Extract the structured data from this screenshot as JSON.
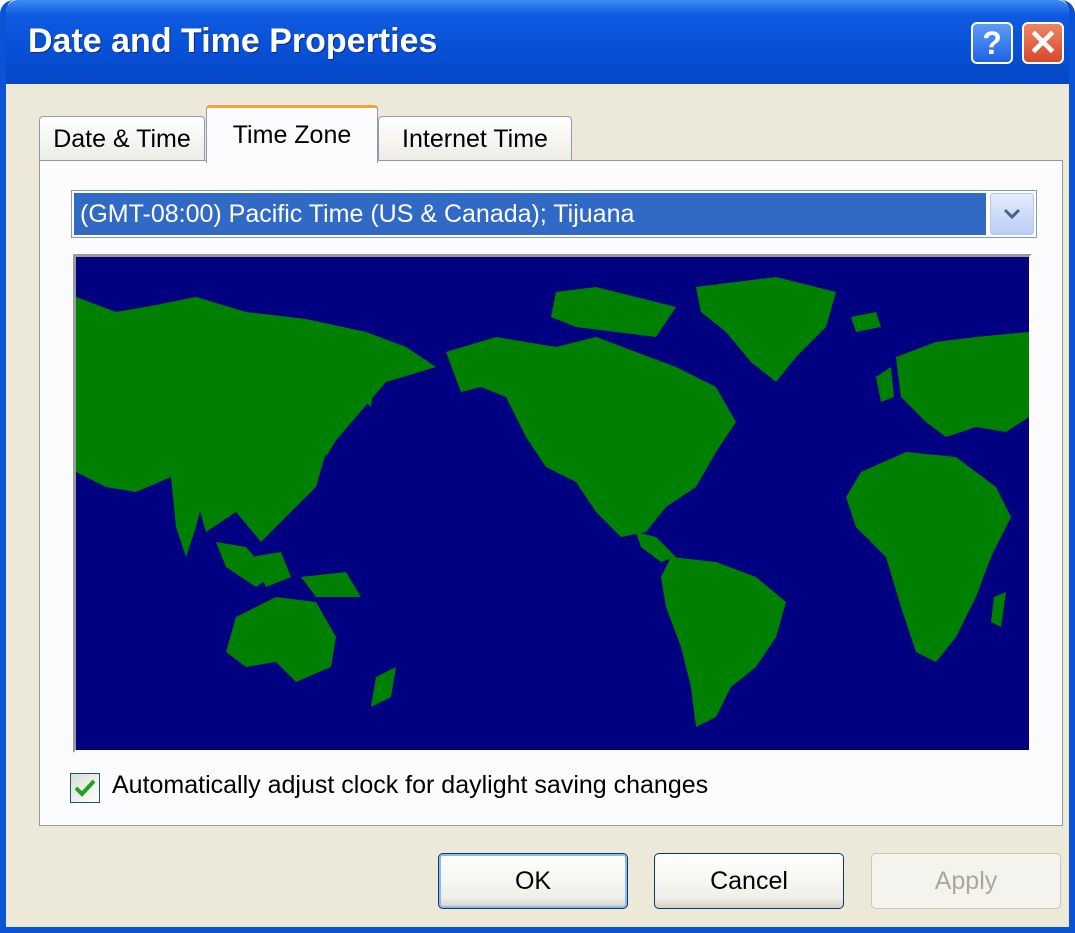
{
  "window": {
    "title": "Date and Time Properties",
    "help_label": "?",
    "close_label": "✕"
  },
  "tabs": [
    {
      "label": "Date & Time",
      "active": false
    },
    {
      "label": "Time Zone",
      "active": true
    },
    {
      "label": "Internet Time",
      "active": false
    }
  ],
  "time_zone": {
    "selected": "(GMT-08:00) Pacific Time (US & Canada); Tijuana"
  },
  "map": {
    "ocean_color": "#000080",
    "land_color": "#008000"
  },
  "daylight_saving": {
    "checked": true,
    "label": "Automatically adjust clock for daylight saving changes"
  },
  "buttons": {
    "ok": "OK",
    "cancel": "Cancel",
    "apply": "Apply",
    "apply_enabled": false
  },
  "colors": {
    "title_bar": "#0750d6",
    "selection": "#316ac5",
    "tab_highlight": "#f3a13b",
    "checkmark": "#21a121"
  }
}
